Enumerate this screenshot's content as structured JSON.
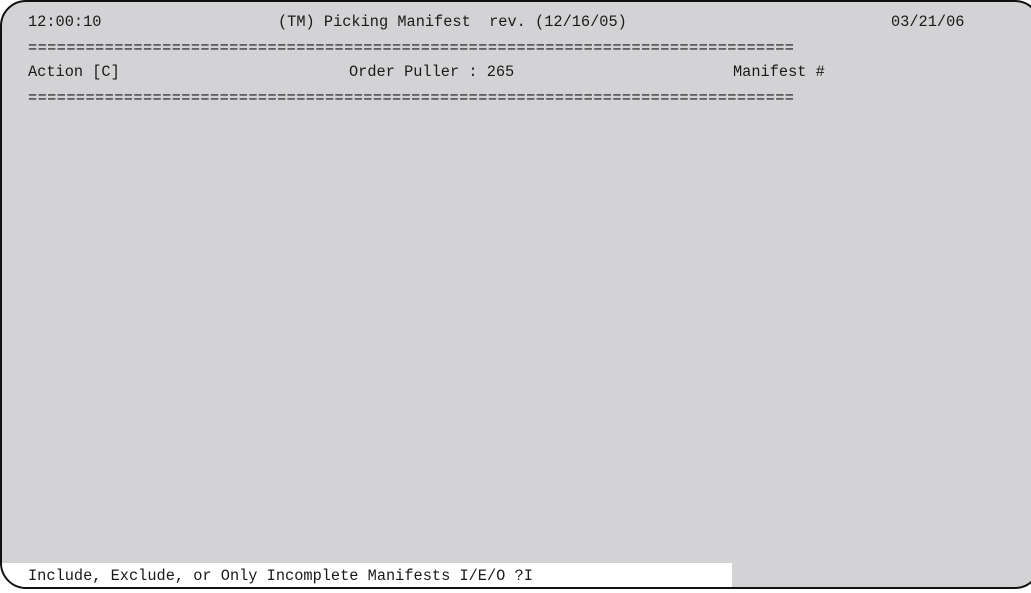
{
  "header": {
    "time": "12:00:10",
    "title": "(TM) Picking Manifest  rev. (12/16/05)",
    "date": "03/21/06"
  },
  "rule": "================================================================================",
  "fields": {
    "action": "Action [C]",
    "order_puller": "Order Puller : 265",
    "manifest": "Manifest #"
  },
  "prompt": {
    "text": "Include, Exclude, or Only Incomplete Manifests I/E/O ?I"
  }
}
